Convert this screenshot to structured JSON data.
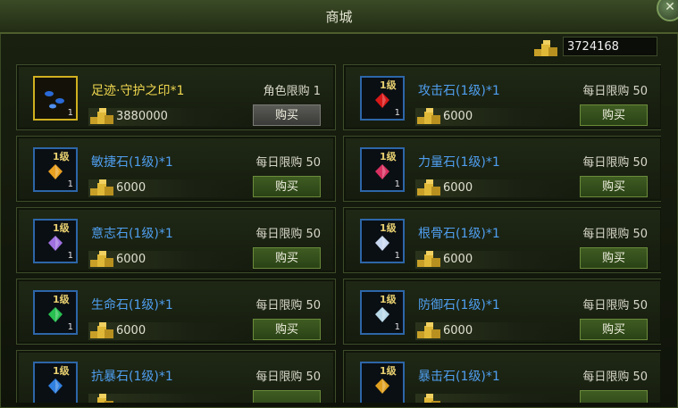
{
  "window": {
    "title": "商城",
    "close_icon": "close-icon"
  },
  "currency": {
    "icon": "gold-coins-icon",
    "amount": "3724168"
  },
  "items": [
    {
      "name": "足迹·守护之印*1",
      "limit": "角色限购 1",
      "price": "3880000",
      "qty": "1",
      "level_badge": "",
      "buy_label": "购买",
      "slot_style": "gold",
      "button_style": "grey",
      "gem_color": "#2a6ad8"
    },
    {
      "name": "攻击石(1级)*1",
      "limit": "每日限购 50",
      "price": "6000",
      "qty": "1",
      "level_badge": "1级",
      "buy_label": "购买",
      "slot_style": "blue",
      "button_style": "green",
      "gem_color": "#d81818"
    },
    {
      "name": "敏捷石(1级)*1",
      "limit": "每日限购 50",
      "price": "6000",
      "qty": "1",
      "level_badge": "1级",
      "buy_label": "购买",
      "slot_style": "blue",
      "button_style": "green",
      "gem_color": "#e8a020"
    },
    {
      "name": "力量石(1级)*1",
      "limit": "每日限购 50",
      "price": "6000",
      "qty": "1",
      "level_badge": "1级",
      "buy_label": "购买",
      "slot_style": "blue",
      "button_style": "green",
      "gem_color": "#d83060"
    },
    {
      "name": "意志石(1级)*1",
      "limit": "每日限购 50",
      "price": "6000",
      "qty": "1",
      "level_badge": "1级",
      "buy_label": "购买",
      "slot_style": "blue",
      "button_style": "green",
      "gem_color": "#a070e0"
    },
    {
      "name": "根骨石(1级)*1",
      "limit": "每日限购 50",
      "price": "6000",
      "qty": "1",
      "level_badge": "1级",
      "buy_label": "购买",
      "slot_style": "blue",
      "button_style": "green",
      "gem_color": "#c8d8f0"
    },
    {
      "name": "生命石(1级)*1",
      "limit": "每日限购 50",
      "price": "6000",
      "qty": "1",
      "level_badge": "1级",
      "buy_label": "购买",
      "slot_style": "blue",
      "button_style": "green",
      "gem_color": "#28c050"
    },
    {
      "name": "防御石(1级)*1",
      "limit": "每日限购 50",
      "price": "6000",
      "qty": "1",
      "level_badge": "1级",
      "buy_label": "购买",
      "slot_style": "blue",
      "button_style": "green",
      "gem_color": "#b8d8e8"
    },
    {
      "name": "抗暴石(1级)*1",
      "limit": "每日限购 50",
      "price": "",
      "qty": "",
      "level_badge": "1级",
      "buy_label": "",
      "slot_style": "blue",
      "button_style": "green",
      "gem_color": "#3080e0"
    },
    {
      "name": "暴击石(1级)*1",
      "limit": "每日限购 50",
      "price": "",
      "qty": "",
      "level_badge": "1级",
      "buy_label": "",
      "slot_style": "blue",
      "button_style": "green",
      "gem_color": "#e0a020"
    }
  ]
}
